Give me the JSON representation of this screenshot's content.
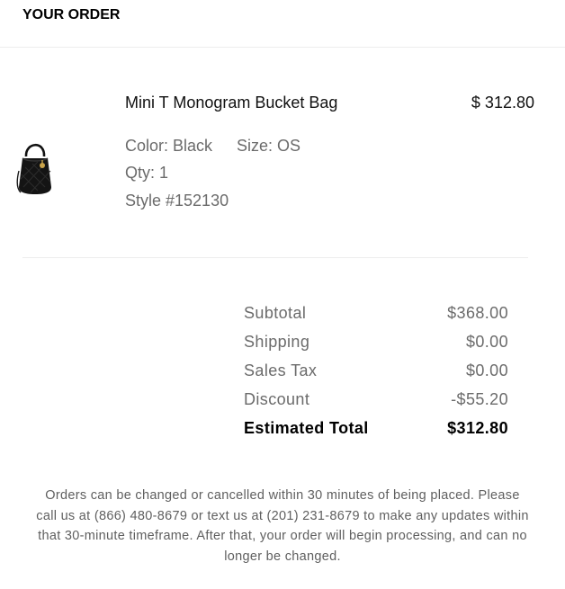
{
  "header": {
    "title": "YOUR ORDER"
  },
  "item": {
    "name": "Mini T Monogram Bucket Bag",
    "price": "$ 312.80",
    "color": "Color: Black",
    "size": "Size: OS",
    "qty": "Qty: 1",
    "style": "Style #152130",
    "thumbnail_icon": "bucket-bag-image"
  },
  "summary": {
    "rows": [
      {
        "label": "Subtotal",
        "value": "$368.00"
      },
      {
        "label": "Shipping",
        "value": "$0.00"
      },
      {
        "label": "Sales Tax",
        "value": "$0.00"
      },
      {
        "label": "Discount",
        "value": "-$55.20"
      }
    ],
    "total": {
      "label": "Estimated Total",
      "value": "$312.80"
    }
  },
  "footer": {
    "note": "Orders can be changed or cancelled within 30 minutes of being placed. Please call us at (866) 480-8679 or text us at (201) 231-8679 to make any updates within that 30-minute timeframe. After that, your order will begin processing, and can no longer be changed."
  }
}
